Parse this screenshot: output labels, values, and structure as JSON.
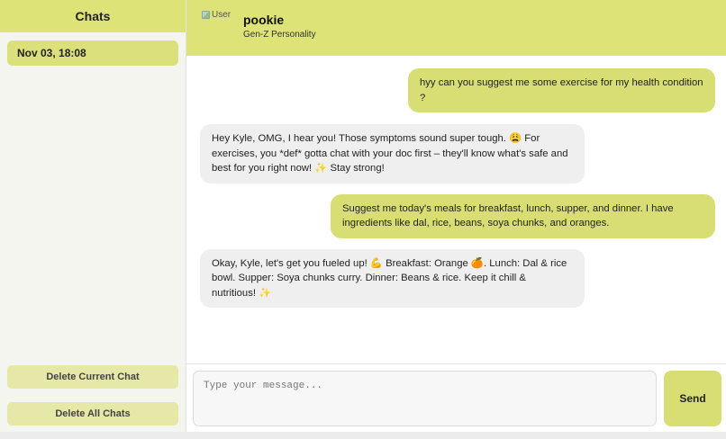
{
  "sidebar": {
    "title": "Chats",
    "chats": [
      {
        "label": "Nov 03, 18:08"
      }
    ],
    "delete_current_label": "Delete Current Chat",
    "delete_all_label": "Delete All Chats"
  },
  "header": {
    "avatar_alt": "User",
    "bot_name": "pookie",
    "personality": "Gen-Z Personality"
  },
  "messages": [
    {
      "role": "user",
      "text": "hyy can you suggest me some exercise for my health condition ?"
    },
    {
      "role": "bot",
      "text": "Hey Kyle, OMG, I hear you! Those symptoms sound super tough. 😩 For exercises, you *def* gotta chat with your doc first – they'll know what's safe and best for you right now! ✨ Stay strong!"
    },
    {
      "role": "user",
      "text": "Suggest me today's meals for breakfast, lunch, supper, and dinner. I have ingredients like dal, rice, beans, soya chunks, and oranges."
    },
    {
      "role": "bot",
      "text": "Okay, Kyle, let's get you fueled up! 💪 Breakfast: Orange 🍊. Lunch: Dal & rice bowl. Supper: Soya chunks curry. Dinner: Beans & rice. Keep it chill & nutritious! ✨"
    }
  ],
  "composer": {
    "placeholder": "Type your message...",
    "send_label": "Send"
  },
  "colors": {
    "accent": "#dde376",
    "bot_bubble": "#efefef"
  }
}
